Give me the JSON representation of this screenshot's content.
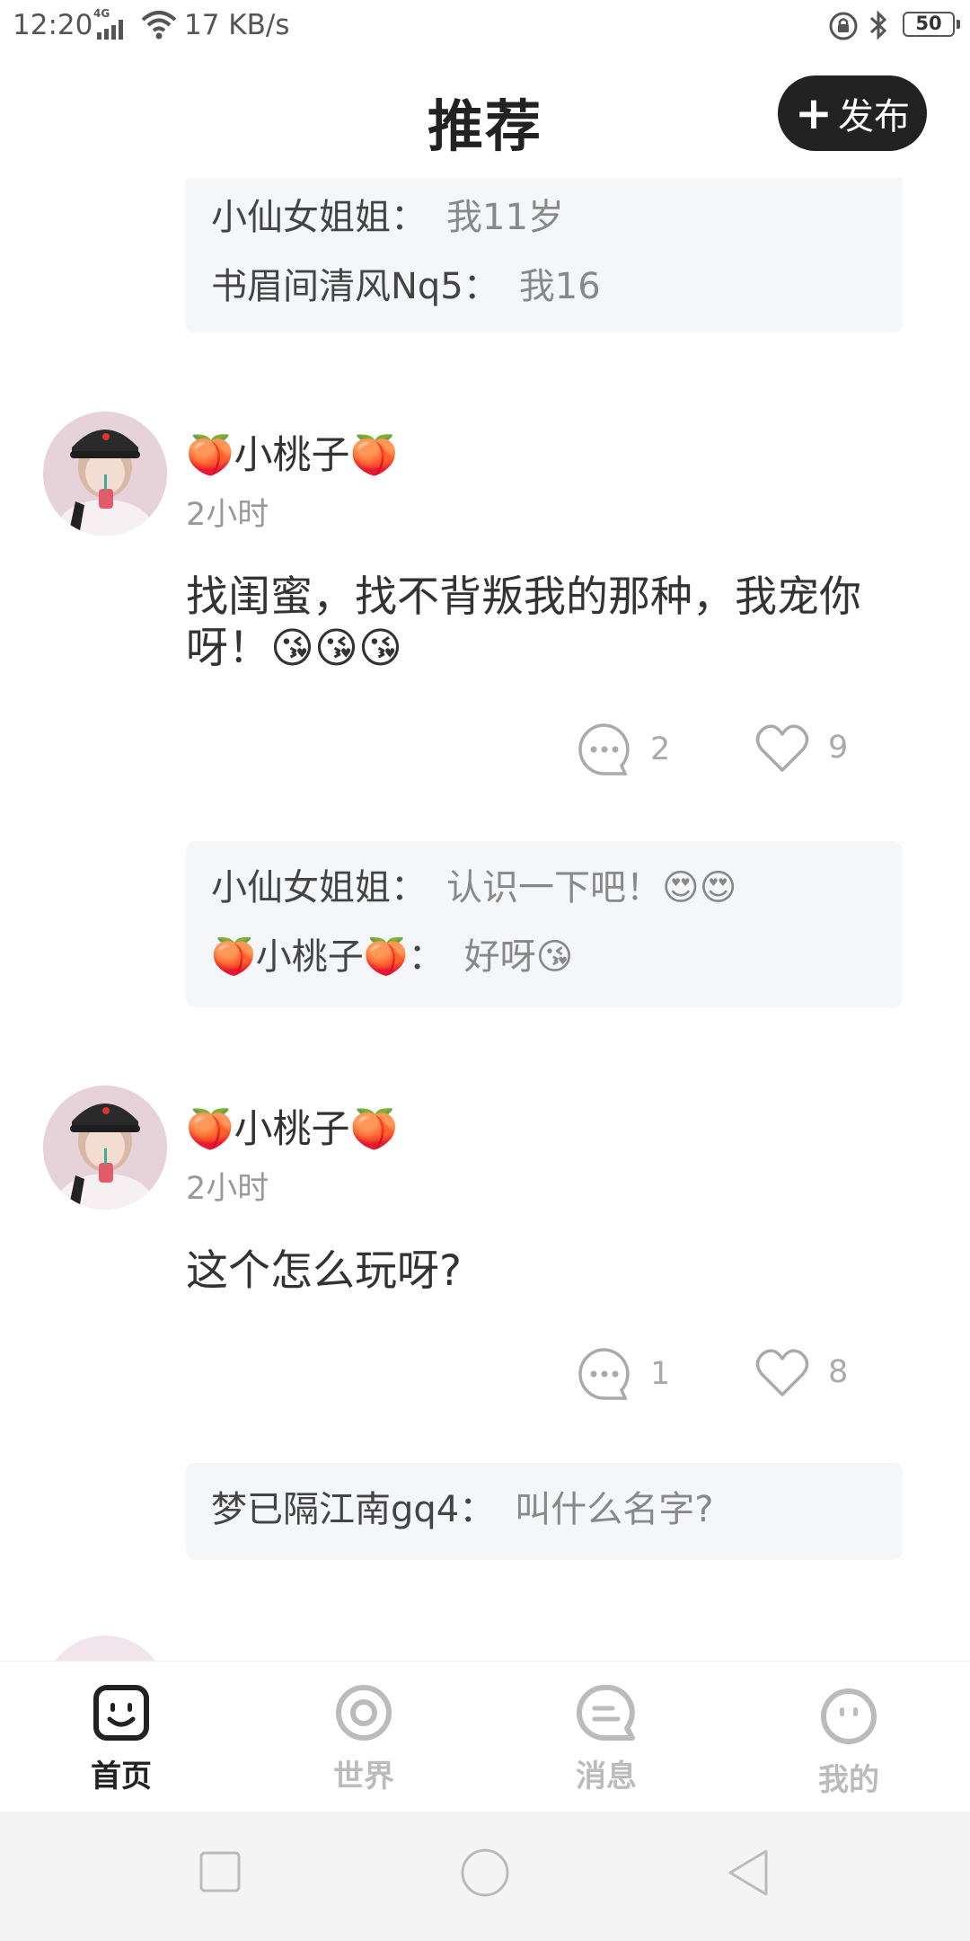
{
  "status_bar": {
    "time": "12:20",
    "network": "4G",
    "speed": "17 KB/s",
    "battery": "50"
  },
  "header": {
    "title": "推荐",
    "publish_label": "发布"
  },
  "feed": {
    "top_comments": [
      {
        "user": "小仙女姐姐：",
        "text": "我11岁"
      },
      {
        "user": "书眉间清风Nq5：",
        "text": "我16"
      }
    ],
    "posts": [
      {
        "username": "🍑小桃子🍑",
        "time": "2小时",
        "text": "找闺蜜，找不背叛我的那种，我宠你呀！😘😘😘",
        "comment_count": "2",
        "like_count": "9",
        "comments": [
          {
            "user": "小仙女姐姐：",
            "text": "认识一下吧！😍😍"
          },
          {
            "user": "🍑小桃子🍑：",
            "text": "好呀😘"
          }
        ]
      },
      {
        "username": "🍑小桃子🍑",
        "time": "2小时",
        "text": "这个怎么玩呀?",
        "comment_count": "1",
        "like_count": "8",
        "comments": [
          {
            "user": "梦已隔江南gq4：",
            "text": "叫什么名字?"
          }
        ]
      }
    ]
  },
  "bottom_nav": {
    "items": [
      {
        "label": "首页",
        "icon": "home-face-icon",
        "active": true
      },
      {
        "label": "世界",
        "icon": "world-target-icon",
        "active": false
      },
      {
        "label": "消息",
        "icon": "message-bubble-icon",
        "active": false
      },
      {
        "label": "我的",
        "icon": "profile-face-icon",
        "active": false
      }
    ]
  },
  "system_nav": {
    "icons": [
      "recent-apps-icon",
      "home-circle-icon",
      "back-triangle-icon"
    ]
  },
  "colors": {
    "primary_dark": "#222222",
    "comment_bg": "#f5f6f8",
    "muted_text": "#999999",
    "inactive_nav": "#bbbbbb"
  }
}
